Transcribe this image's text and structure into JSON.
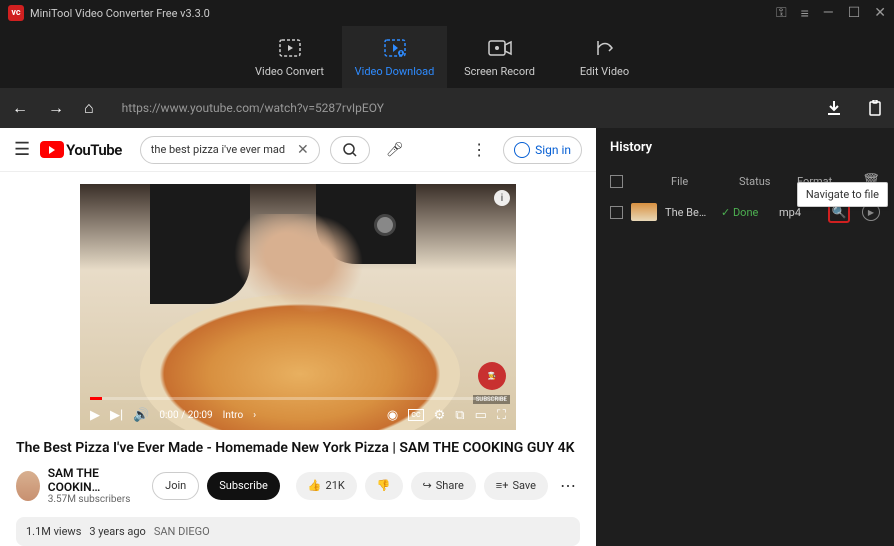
{
  "titlebar": {
    "app_title": "MiniTool Video Converter Free v3.3.0"
  },
  "tabs": {
    "convert": "Video Convert",
    "download": "Video Download",
    "record": "Screen Record",
    "edit": "Edit Video"
  },
  "nav": {
    "url": "https://www.youtube.com/watch?v=5287rvIpEOY"
  },
  "youtube": {
    "brand": "YouTube",
    "search_value": "the best pizza i've ever mad",
    "signin": "Sign in",
    "video_title": "The Best Pizza I've Ever Made - Homemade New York Pizza | SAM THE COOKING GUY 4K",
    "channel_name": "SAM THE COOKIN…",
    "subscribers": "3.57M subscribers",
    "join": "Join",
    "subscribe": "Subscribe",
    "likes": "21K",
    "share": "Share",
    "save": "Save",
    "time": "0:00 / 20:09",
    "chapter": "Intro",
    "views": "1.1M views",
    "age": "3 years ago",
    "location": "SAN DIEGO",
    "sub_badge": "SUBSCRIBE"
  },
  "history": {
    "title": "History",
    "col_file": "File",
    "col_status": "Status",
    "col_format": "Format",
    "items": [
      {
        "name": "The Be…",
        "status": "✓ Done",
        "format": "mp4"
      }
    ],
    "tooltip": "Navigate to file"
  }
}
